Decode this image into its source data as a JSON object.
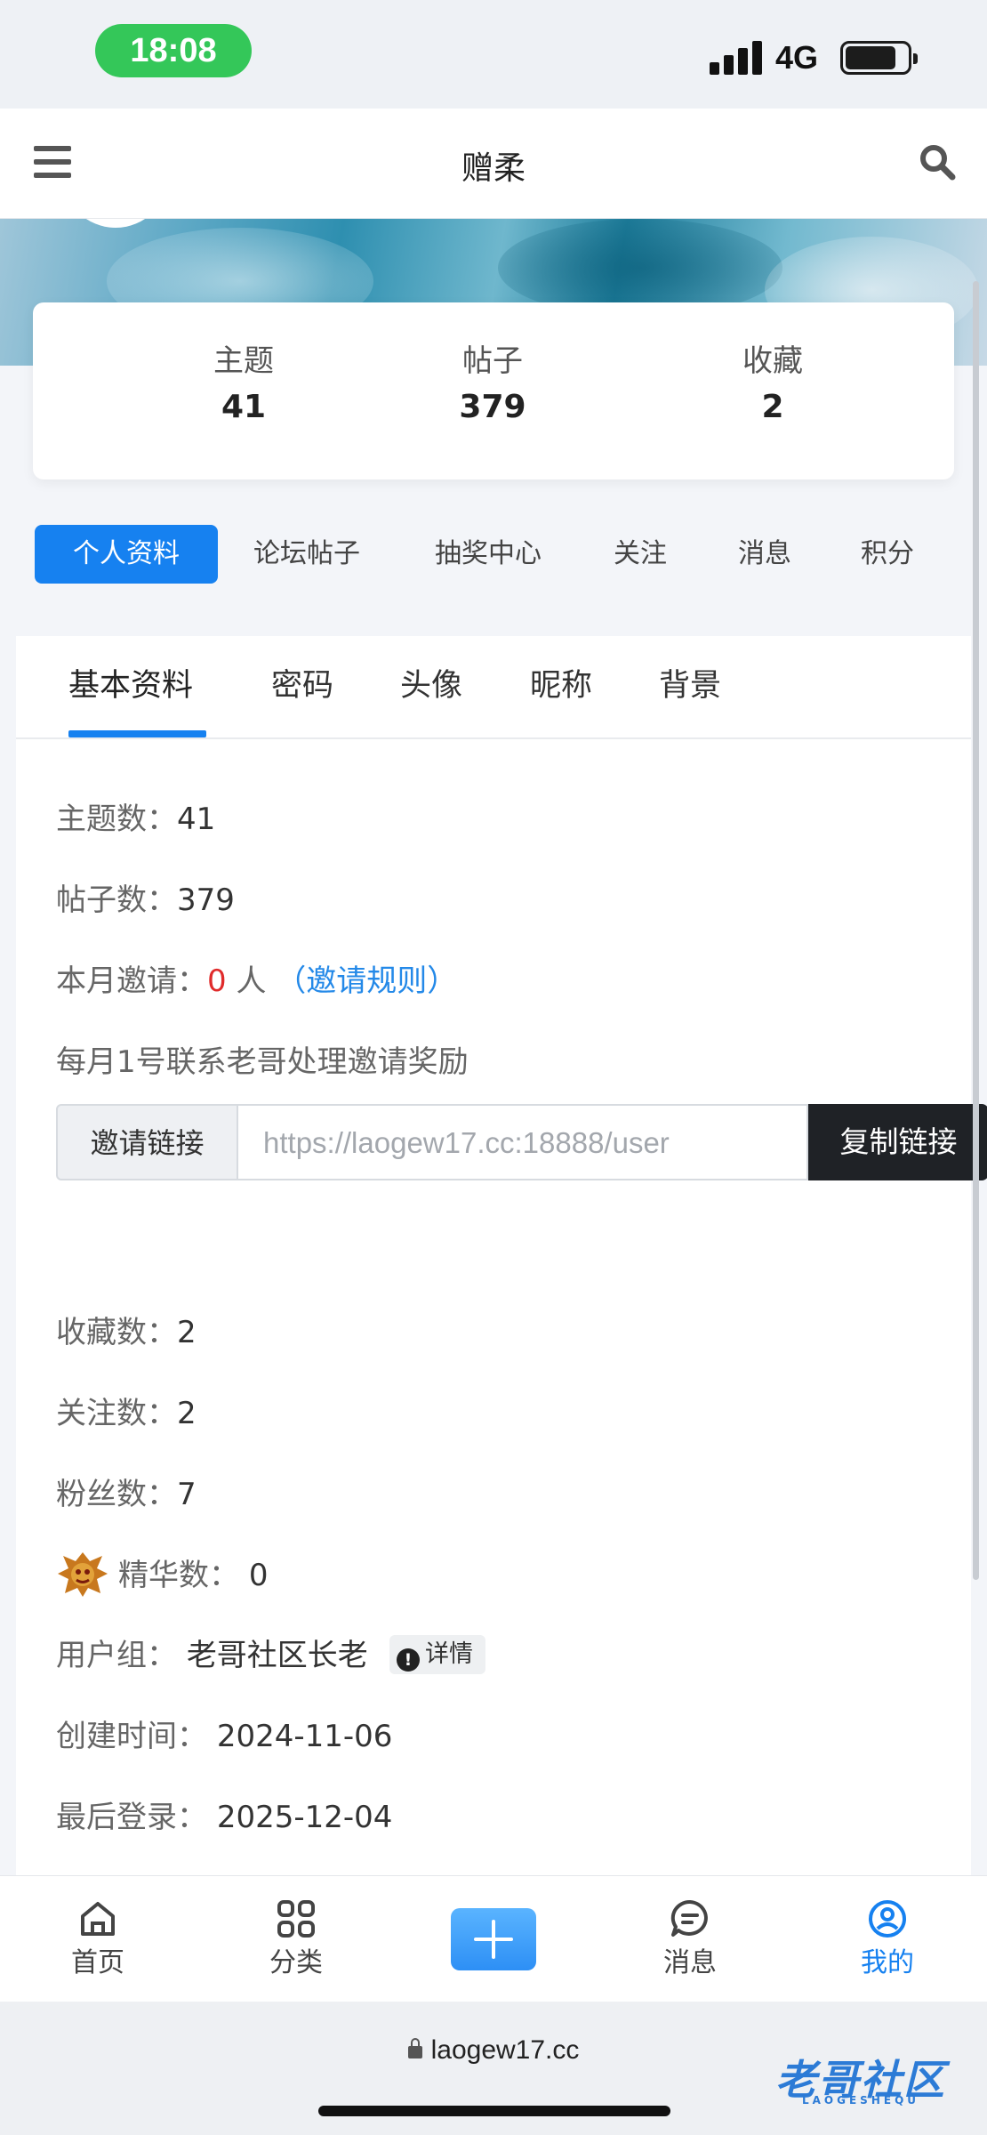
{
  "status_bar": {
    "time": "18:08",
    "network": "4G"
  },
  "nav": {
    "title": "赠柔",
    "menu_icon": "hamburger-menu-icon",
    "search_icon": "search-icon"
  },
  "stats": [
    {
      "label": "主题",
      "value": "41"
    },
    {
      "label": "帖子",
      "value": "379"
    },
    {
      "label": "收藏",
      "value": "2"
    }
  ],
  "profile_tabs": [
    "个人资料",
    "论坛帖子",
    "抽奖中心",
    "关注",
    "消息",
    "积分"
  ],
  "profile_tabs_active": "个人资料",
  "sub_tabs": [
    "基本资料",
    "密码",
    "头像",
    "昵称",
    "背景"
  ],
  "sub_tabs_active": "基本资料",
  "info": {
    "topics_label": "主题数：",
    "topics_value": "41",
    "posts_label": "帖子数：",
    "posts_value": "379",
    "invite_label": "本月邀请：",
    "invite_count": "0",
    "invite_unit": "人",
    "invite_rules": "（邀请规则）",
    "invite_note": "每月1号联系老哥处理邀请奖励",
    "invite_link_label": "邀请链接",
    "invite_link_value": "https://laogew17.cc:18888/user",
    "copy_button": "复制链接",
    "favorites_label": "收藏数：",
    "favorites_value": "2",
    "following_label": "关注数：",
    "following_value": "2",
    "fans_label": "粉丝数：",
    "fans_value": "7",
    "essence_label": "精华数：",
    "essence_value": "0",
    "group_label": "用户组：",
    "group_value": "老哥社区长老",
    "group_detail": "详情",
    "created_label": "创建时间：",
    "created_value": "2024-11-06",
    "last_login_label": "最后登录：",
    "last_login_value": "2025-12-04"
  },
  "bottom_nav": [
    {
      "label": "首页",
      "icon": "home-icon"
    },
    {
      "label": "分类",
      "icon": "grid-icon"
    },
    {
      "label": "",
      "icon": "plus-icon"
    },
    {
      "label": "消息",
      "icon": "chat-icon"
    },
    {
      "label": "我的",
      "icon": "user-icon"
    }
  ],
  "bottom_nav_active": "我的",
  "browser": {
    "url": "laogew17.cc"
  },
  "watermark": {
    "text": "老哥社区",
    "sub": "LAOGESHEQU"
  },
  "colors": {
    "accent": "#1681f0",
    "red": "#e02b2b",
    "link": "#2489e8",
    "status_green": "#34c759"
  }
}
